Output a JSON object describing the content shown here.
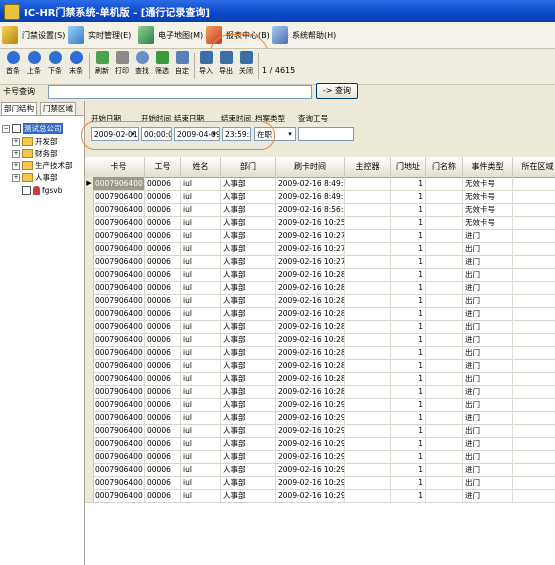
{
  "window": {
    "title": "IC-HR门禁系统-单机版 - [通行记录查询]"
  },
  "menu": [
    {
      "label": "门禁设置(S)",
      "icon": "key-icon"
    },
    {
      "label": "实时管理(E)",
      "icon": "document-icon"
    },
    {
      "label": "电子地图(M)",
      "icon": "map-icon"
    },
    {
      "label": "报表中心(B)",
      "icon": "report-icon"
    },
    {
      "label": "系统帮助(H)",
      "icon": "help-book-icon"
    }
  ],
  "toolbar": {
    "buttons": [
      {
        "label": "首条",
        "icon": "first-record-icon"
      },
      {
        "label": "上条",
        "icon": "previous-record-icon"
      },
      {
        "label": "下条",
        "icon": "next-record-icon"
      },
      {
        "label": "末条",
        "icon": "last-record-icon"
      },
      {
        "label": "刷新",
        "icon": "refresh-icon"
      },
      {
        "label": "打印",
        "icon": "print-icon"
      },
      {
        "label": "查找",
        "icon": "find-icon"
      },
      {
        "label": "筛选",
        "icon": "filter-icon"
      },
      {
        "label": "自定",
        "icon": "customize-icon"
      },
      {
        "label": "导入",
        "icon": "import-icon"
      },
      {
        "label": "导出",
        "icon": "export-icon"
      },
      {
        "label": "关闭",
        "icon": "close-icon"
      }
    ],
    "pager": "1 / 4615"
  },
  "search": {
    "label": "卡号查询",
    "value": "",
    "button_label": "-> 查询"
  },
  "sidebar": {
    "tabs": [
      "部门结构",
      "门禁区域"
    ],
    "root": "测试总公司",
    "items": [
      "开发部",
      "财务部",
      "生产技术部",
      "人事部",
      "fgsvb"
    ]
  },
  "filters": {
    "start_date_label": "开始日期",
    "start_date": "2009-02-01",
    "start_time_label": "开始时间",
    "start_time": "00:00:00",
    "end_date_label": "结束日期",
    "end_date": "2009-04-09",
    "end_time_label": "结束时间",
    "end_time": "23:59:59",
    "archive_type_label": "档案类型",
    "archive_type": "在职",
    "query_id_label": "查询工号",
    "query_id": ""
  },
  "table": {
    "columns": [
      "卡号",
      "工号",
      "姓名",
      "部门",
      "刷卡时间",
      "主控器",
      "门地址",
      "门名称",
      "事件类型",
      "所在区域"
    ],
    "rows": [
      [
        "0007906400",
        "00006",
        "iul",
        "人事部",
        "2009-02-16 8:49:19",
        "",
        "1",
        "",
        "无效卡号",
        ""
      ],
      [
        "0007906400",
        "00006",
        "iul",
        "人事部",
        "2009-02-16 8:49:21",
        "",
        "1",
        "",
        "无效卡号",
        ""
      ],
      [
        "0007906400",
        "00006",
        "iul",
        "人事部",
        "2009-02-16 8:56:35",
        "",
        "1",
        "",
        "无效卡号",
        ""
      ],
      [
        "0007906400",
        "00006",
        "iul",
        "人事部",
        "2009-02-16 10:25:22",
        "",
        "1",
        "",
        "无效卡号",
        ""
      ],
      [
        "0007906400",
        "00006",
        "iul",
        "人事部",
        "2009-02-16 10:27:55",
        "",
        "1",
        "",
        "进门",
        ""
      ],
      [
        "0007906400",
        "00006",
        "iul",
        "人事部",
        "2009-02-16 10:27:57",
        "",
        "1",
        "",
        "出门",
        ""
      ],
      [
        "0007906400",
        "00006",
        "iul",
        "人事部",
        "2009-02-16 10:27:58",
        "",
        "1",
        "",
        "进门",
        ""
      ],
      [
        "0007906400",
        "00006",
        "iul",
        "人事部",
        "2009-02-16 10:28:03",
        "",
        "1",
        "",
        "出门",
        ""
      ],
      [
        "0007906400",
        "00006",
        "iul",
        "人事部",
        "2009-02-16 10:28:04",
        "",
        "1",
        "",
        "进门",
        ""
      ],
      [
        "0007906400",
        "00006",
        "iul",
        "人事部",
        "2009-02-16 10:28:33",
        "",
        "1",
        "",
        "出门",
        ""
      ],
      [
        "0007906400",
        "00006",
        "iul",
        "人事部",
        "2009-02-16 10:28:35",
        "",
        "1",
        "",
        "进门",
        ""
      ],
      [
        "0007906400",
        "00006",
        "iul",
        "人事部",
        "2009-02-16 10:28:36",
        "",
        "1",
        "",
        "出门",
        ""
      ],
      [
        "0007906400",
        "00006",
        "iul",
        "人事部",
        "2009-02-16 10:28:38",
        "",
        "1",
        "",
        "进门",
        ""
      ],
      [
        "0007906400",
        "00006",
        "iul",
        "人事部",
        "2009-02-16 10:28:39",
        "",
        "1",
        "",
        "出门",
        ""
      ],
      [
        "0007906400",
        "00006",
        "iul",
        "人事部",
        "2009-02-16 10:28:41",
        "",
        "1",
        "",
        "进门",
        ""
      ],
      [
        "0007906400",
        "00006",
        "iul",
        "人事部",
        "2009-02-16 10:28:42",
        "",
        "1",
        "",
        "出门",
        ""
      ],
      [
        "0007906400",
        "00006",
        "iul",
        "人事部",
        "2009-02-16 10:28:58",
        "",
        "1",
        "",
        "进门",
        ""
      ],
      [
        "0007906400",
        "00006",
        "iul",
        "人事部",
        "2009-02-16 10:29:00",
        "",
        "1",
        "",
        "出门",
        ""
      ],
      [
        "0007906400",
        "00006",
        "iul",
        "人事部",
        "2009-02-16 10:29:02",
        "",
        "1",
        "",
        "进门",
        ""
      ],
      [
        "0007906400",
        "00006",
        "iul",
        "人事部",
        "2009-02-16 10:29:03",
        "",
        "1",
        "",
        "出门",
        ""
      ],
      [
        "0007906400",
        "00006",
        "iul",
        "人事部",
        "2009-02-16 10:29:05",
        "",
        "1",
        "",
        "进门",
        ""
      ],
      [
        "0007906400",
        "00006",
        "iul",
        "人事部",
        "2009-02-16 10:29:06",
        "",
        "1",
        "",
        "出门",
        ""
      ],
      [
        "0007906400",
        "00006",
        "iul",
        "人事部",
        "2009-02-16 10:29:08",
        "",
        "1",
        "",
        "进门",
        ""
      ],
      [
        "0007906400",
        "00006",
        "iul",
        "人事部",
        "2009-02-16 10:29:09",
        "",
        "1",
        "",
        "出门",
        ""
      ],
      [
        "0007906400",
        "00006",
        "iul",
        "人事部",
        "2009-02-16 10:29:10",
        "",
        "1",
        "",
        "进门",
        ""
      ]
    ]
  },
  "colors": {
    "titlebar": "#0b47c8",
    "highlight_outline": "#f0863a",
    "selection": "#316ac5"
  }
}
